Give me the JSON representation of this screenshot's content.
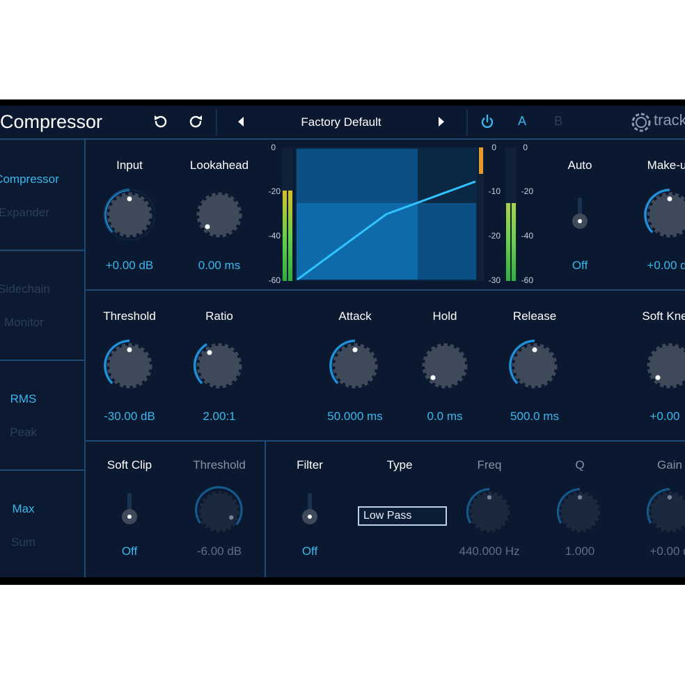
{
  "header": {
    "title": "Compressor",
    "preset_name": "Factory Default",
    "ab_a": "A",
    "ab_b": "B",
    "logo_text": "track"
  },
  "sidebar": {
    "mode_items": [
      "Compressor",
      "Expander"
    ],
    "routing_items": [
      "Sidechain",
      "Monitor"
    ],
    "detector_items": [
      "RMS",
      "Peak"
    ],
    "link_items": [
      "Max",
      "Sum"
    ]
  },
  "top_row": {
    "input": {
      "label": "Input",
      "value": "+0.00 dB"
    },
    "lookahead": {
      "label": "Lookahead",
      "value": "0.00 ms"
    },
    "auto": {
      "label": "Auto",
      "value": "Off"
    },
    "makeup": {
      "label": "Make-u",
      "value": "+0.00 d"
    }
  },
  "graph": {
    "left_scale": [
      "0",
      "-20",
      "-40",
      "-60"
    ],
    "gr_scale": [
      "0",
      "-10",
      "-20",
      "-30"
    ],
    "right_scale": [
      "0",
      "-20",
      "-40",
      "-60"
    ],
    "input_meter_level": 0.7,
    "gr_meter_level": 0.2,
    "output_meter_level": 0.6
  },
  "mid_row": {
    "threshold": {
      "label": "Threshold",
      "value": "-30.00 dB"
    },
    "ratio": {
      "label": "Ratio",
      "value": "2.00:1"
    },
    "attack": {
      "label": "Attack",
      "value": "50.000 ms"
    },
    "hold": {
      "label": "Hold",
      "value": "0.0 ms"
    },
    "release": {
      "label": "Release",
      "value": "500.0 ms"
    },
    "soft_knee": {
      "label": "Soft Kne",
      "value": "+0.00"
    }
  },
  "bottom_row": {
    "soft_clip": {
      "label": "Soft Clip",
      "value": "Off"
    },
    "clip_threshold": {
      "label": "Threshold",
      "value": "-6.00 dB"
    },
    "filter": {
      "label": "Filter",
      "value": "Off"
    },
    "type": {
      "label": "Type",
      "selected": "Low Pass"
    },
    "freq": {
      "label": "Freq",
      "value": "440.000 Hz"
    },
    "q": {
      "label": "Q",
      "value": "1.000"
    },
    "gain": {
      "label": "Gain",
      "value": "+0.00 d"
    }
  },
  "colors": {
    "accent": "#3ab8ee",
    "background": "#0a1930",
    "divider": "#1d4a75",
    "arc": "#1f8fd6",
    "meter_green": "#38c24a",
    "meter_orange": "#e39a2a"
  }
}
